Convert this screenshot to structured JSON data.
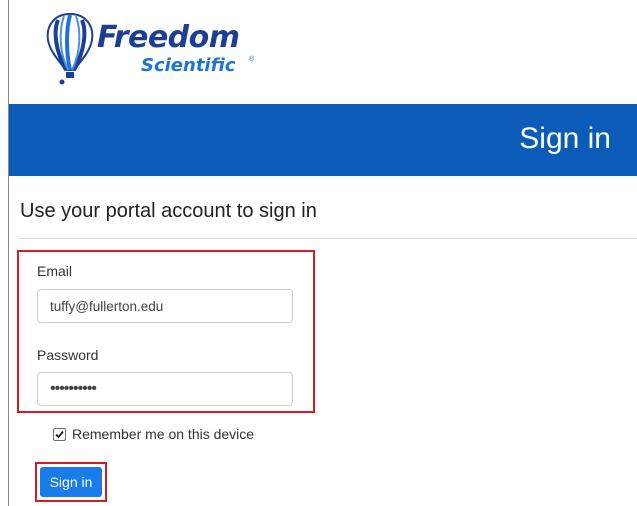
{
  "brand": {
    "name_line1": "Freedom",
    "name_line2": "Scientific",
    "trademark": "®",
    "primary_color": "#1c3f95",
    "secondary_color": "#1f73d6"
  },
  "banner": {
    "title": "Sign in",
    "background_color": "#0b5bb8"
  },
  "form": {
    "subtitle": "Use your portal account to sign in",
    "email": {
      "label": "Email",
      "value": "tuffy@fullerton.edu"
    },
    "password": {
      "label": "Password",
      "value": "••••••••••"
    },
    "remember": {
      "label": "Remember me on this device",
      "checked": true
    },
    "submit_label": "Sign in",
    "highlight_color": "#d11a2a",
    "button_color": "#1a7bea"
  },
  "icons": {
    "logo": "hot-air-balloon-logo",
    "checkmark": "checkmark-icon"
  }
}
